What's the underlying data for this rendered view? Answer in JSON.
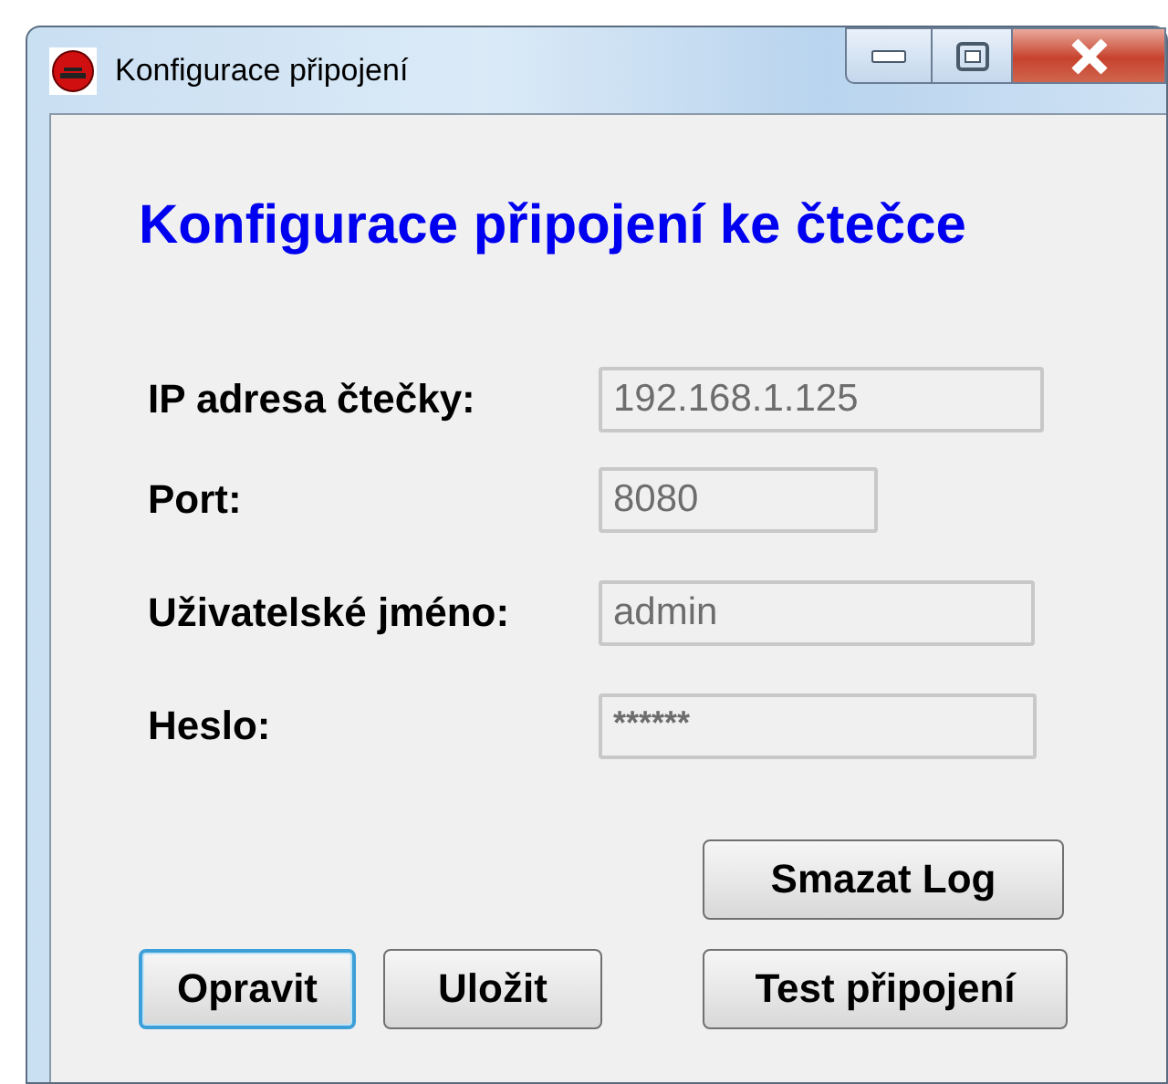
{
  "window": {
    "title": "Konfigurace připojení"
  },
  "heading": "Konfigurace připojení ke čtečce",
  "fields": [
    {
      "label": "IP adresa čtečky:",
      "value": "192.168.1.125",
      "disabled": true
    },
    {
      "label": "Port:",
      "value": "8080",
      "disabled": true
    },
    {
      "label": "Uživatelské jméno:",
      "value": "admin",
      "disabled": true
    },
    {
      "label": "Heslo:",
      "value": "******",
      "disabled": true
    }
  ],
  "buttons": [
    {
      "label": "Smazat Log",
      "focused": false
    },
    {
      "label": "Opravit",
      "focused": true
    },
    {
      "label": "Uložit",
      "focused": false
    },
    {
      "label": "Test připojení",
      "focused": false
    }
  ]
}
